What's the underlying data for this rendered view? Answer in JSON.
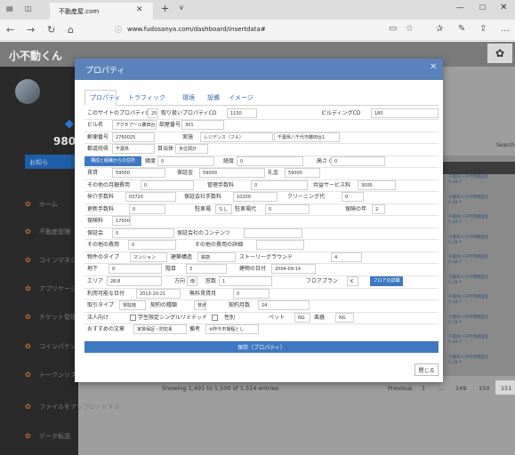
{
  "browser": {
    "tab_title": "不動産屋.com",
    "url": "www.fudosanya.com/dashboard/insertdata#"
  },
  "app": {
    "brand": "小不動くん",
    "sidebar_number": "9800",
    "sidebar_button": "お知ら",
    "sidebar_items": [
      "ホーム",
      "不動産管理",
      "コインマネジ",
      "アプリケーシ",
      "チケット管理",
      "コインパケン",
      "トークンリス",
      "ファイルをアップロードする",
      "データ転送"
    ]
  },
  "background_table": {
    "search_label": "Search",
    "row_texts": [
      "千葉県八千代市勝田台",
      "5-18-7"
    ],
    "info": "Showing 1,491 to 1,500 of 1,514 entries",
    "prev": "Previous",
    "pages": [
      "1",
      "...",
      "149",
      "150",
      "151"
    ]
  },
  "modal": {
    "title": "プロパティ",
    "tabs": [
      "プロパティ",
      "トラフィック",
      "環境",
      "設備",
      "イメージ"
    ],
    "rows": [
      [
        [
          "lbl",
          "このサイトのプロパティCD"
        ],
        [
          "fld",
          "25"
        ],
        [
          "lbl",
          "取り扱いプロパティCD"
        ],
        [
          "fld",
          "1150"
        ],
        [
          "lbl",
          "ビルディングCD"
        ],
        [
          "fld",
          "180"
        ]
      ],
      [
        [
          "lbl",
          "ビル名"
        ],
        [
          "fld",
          "アクタプール勝田台"
        ],
        [
          "lbl",
          "部屋番号"
        ],
        [
          "fld",
          "301"
        ]
      ],
      [
        [
          "lbl",
          "郵便番号"
        ],
        [
          "fld",
          "2760025"
        ],
        [
          "lbl",
          "実施"
        ],
        [
          "fld",
          "レジデンス（フル）"
        ],
        [
          "fld",
          "千葉県八千代市勝田台1"
        ]
      ],
      [
        [
          "lbl",
          "都道府県"
        ],
        [
          "fld",
          "千葉県"
        ],
        [
          "lbl",
          "目治体"
        ],
        [
          "fld",
          "多位頭計"
        ]
      ],
      [
        [
          "btn",
          "構成と組繊からの住所"
        ],
        [
          "lbl",
          "緯度"
        ],
        [
          "fld",
          "0"
        ],
        [
          "lbl",
          "経度"
        ],
        [
          "fld",
          "0"
        ],
        [
          "lbl",
          "高さ (m)"
        ],
        [
          "fld",
          "0"
        ]
      ],
      [
        [
          "lbl",
          "賃貸"
        ],
        [
          "fld",
          "59000"
        ],
        [
          "lbl",
          "保証金"
        ],
        [
          "fld",
          "59000"
        ],
        [
          "lbl",
          "礼金"
        ],
        [
          "fld",
          "59000"
        ]
      ],
      [
        [
          "lbl",
          "その他の月額費用"
        ],
        [
          "fld",
          "0"
        ],
        [
          "lbl",
          "管理手数料"
        ],
        [
          "fld",
          "0"
        ],
        [
          "lbl",
          "共益サービス料"
        ],
        [
          "fld",
          "3000"
        ]
      ],
      [
        [
          "lbl",
          "仲介手数料"
        ],
        [
          "fld",
          "03720"
        ],
        [
          "lbl",
          "保証会社手数料"
        ],
        [
          "fld",
          "10200"
        ],
        [
          "lbl",
          "クリーニング代"
        ],
        [
          "fld",
          "0"
        ]
      ],
      [
        [
          "lbl",
          "更新手数料"
        ],
        [
          "fld",
          "0"
        ],
        [
          "lbl",
          "駐車場"
        ],
        [
          "fld",
          "なし"
        ],
        [
          "lbl",
          "駐車場代"
        ],
        [
          "fld",
          "0"
        ],
        [
          "lbl",
          "保険の年"
        ],
        [
          "fld",
          "2"
        ]
      ],
      [
        [
          "lbl",
          "保険料"
        ],
        [
          "fld",
          "17000"
        ]
      ],
      [
        [
          "lbl",
          "保証会"
        ],
        [
          "fld",
          "0"
        ],
        [
          "lbl",
          "保証会社のコンテンツ"
        ],
        [
          "fld",
          ""
        ]
      ],
      [
        [
          "lbl",
          "その他の費用"
        ],
        [
          "fld",
          "0"
        ],
        [
          "lbl",
          "その他の費用の詳細"
        ],
        [
          "fld",
          ""
        ]
      ],
      [
        [
          "lbl",
          "物件のタイプ"
        ],
        [
          "fld",
          "マンション"
        ],
        [
          "lbl",
          "建築構造"
        ],
        [
          "fld",
          "鉄筋"
        ],
        [
          "lbl",
          "ストーリーグラウンド"
        ],
        [
          "fld",
          "4"
        ]
      ],
      [
        [
          "lbl",
          "地下"
        ],
        [
          "fld",
          "0"
        ],
        [
          "lbl",
          "階目"
        ],
        [
          "fld",
          "3"
        ],
        [
          "lbl",
          "建物の日付"
        ],
        [
          "fld",
          "2004-09-14"
        ]
      ],
      [
        [
          "lbl",
          "エリア"
        ],
        [
          "fld",
          "28.8"
        ],
        [
          "lbl",
          "方向"
        ],
        [
          "fld",
          "南"
        ],
        [
          "lbl",
          "窓数"
        ],
        [
          "fld",
          "1"
        ],
        [
          "lbl",
          "フロアプラン"
        ],
        [
          "fld",
          "K"
        ],
        [
          "btn",
          "フロアの詳細"
        ]
      ],
      [
        [
          "lbl",
          "利用可能な日付"
        ],
        [
          "fld",
          "2013-10-21"
        ],
        [
          "lbl",
          "無料賃貸月"
        ],
        [
          "fld",
          "0"
        ]
      ],
      [
        [
          "lbl",
          "取引タイプ"
        ],
        [
          "fld",
          "常駐暗"
        ],
        [
          "lbl",
          "契約の種類"
        ],
        [
          "fld",
          "普通"
        ],
        [
          "lbl",
          "契約月数"
        ],
        [
          "fld",
          "24"
        ]
      ],
      [
        [
          "lbl",
          "法人向け"
        ],
        [
          "cb",
          ""
        ],
        [
          "lbl",
          "学生限定シングルリミテッド"
        ],
        [
          "cb",
          ""
        ],
        [
          "lbl",
          "性別"
        ],
        [
          "lbl",
          "ペット"
        ],
        [
          "fld",
          "NG"
        ],
        [
          "lbl",
          "楽器"
        ],
        [
          "fld",
          "NG"
        ]
      ],
      [
        [
          "lbl",
          "おすすめの文章"
        ],
        [
          "fld",
          "家賃保証・防犯系"
        ],
        [
          "lbl",
          "備考"
        ],
        [
          "fld",
          "※昨今市場程とし"
        ]
      ]
    ],
    "save_button": "保存（プロパティ）",
    "close_button": "閉じる"
  }
}
